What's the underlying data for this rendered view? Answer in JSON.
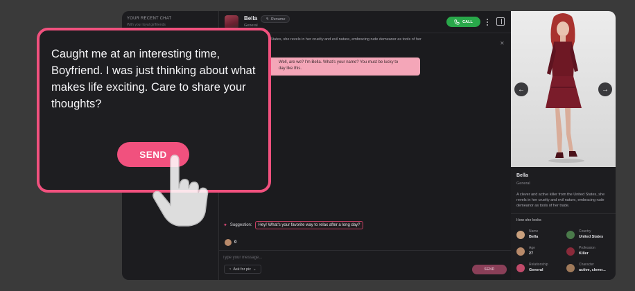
{
  "sidebar": {
    "title": "YOUR RECENT CHAT",
    "subtitle": "With your loyal girlfriends"
  },
  "chat_header": {
    "name": "Bella",
    "category": "General",
    "rename_label": "Rename",
    "call_label": "CALL"
  },
  "intro_banner": "active killer from the United States, she revels in her cruelty and evil nature, embracing rude demeanor as tools of her",
  "message": {
    "text_line1": "Well, are we? I'm Bella. What's your name? You must be lucky to",
    "text_line2": "day like this."
  },
  "suggestion": {
    "label": "Suggestion:",
    "text": "Hey! What's your favorite way to relax after a long day?"
  },
  "coins": "0",
  "composer": {
    "placeholder": "Type your message...",
    "ask_label": "Ask for pic",
    "send_label": "SEND"
  },
  "profile": {
    "name": "Bella",
    "category": "General",
    "description": "A clever and active killer from the United States, she revels in her cruelty and evil nature, embracing rude demeanor as tools of her trade.",
    "looks_title": "How she looks",
    "attributes": [
      {
        "label": "Name",
        "value": "Bella",
        "icon": "name-icon"
      },
      {
        "label": "Country",
        "value": "United States",
        "icon": "globe-icon"
      },
      {
        "label": "Age",
        "value": "27",
        "icon": "age-icon"
      },
      {
        "label": "Profession",
        "value": "Killer",
        "icon": "profession-icon"
      },
      {
        "label": "Relationship",
        "value": "General",
        "icon": "relationship-icon"
      },
      {
        "label": "Character",
        "value": "active, clever...",
        "icon": "character-icon"
      }
    ]
  },
  "popup": {
    "message": "Caught me at an interesting time, Boyfriend. I was just thinking about what makes life exciting. Care to share your thoughts?",
    "send_label": "SEND"
  },
  "colors": {
    "accent": "#f1517e",
    "call_green": "#29a84a",
    "bubble_pink": "#f4a6b8",
    "background": "#3a3a3a"
  }
}
